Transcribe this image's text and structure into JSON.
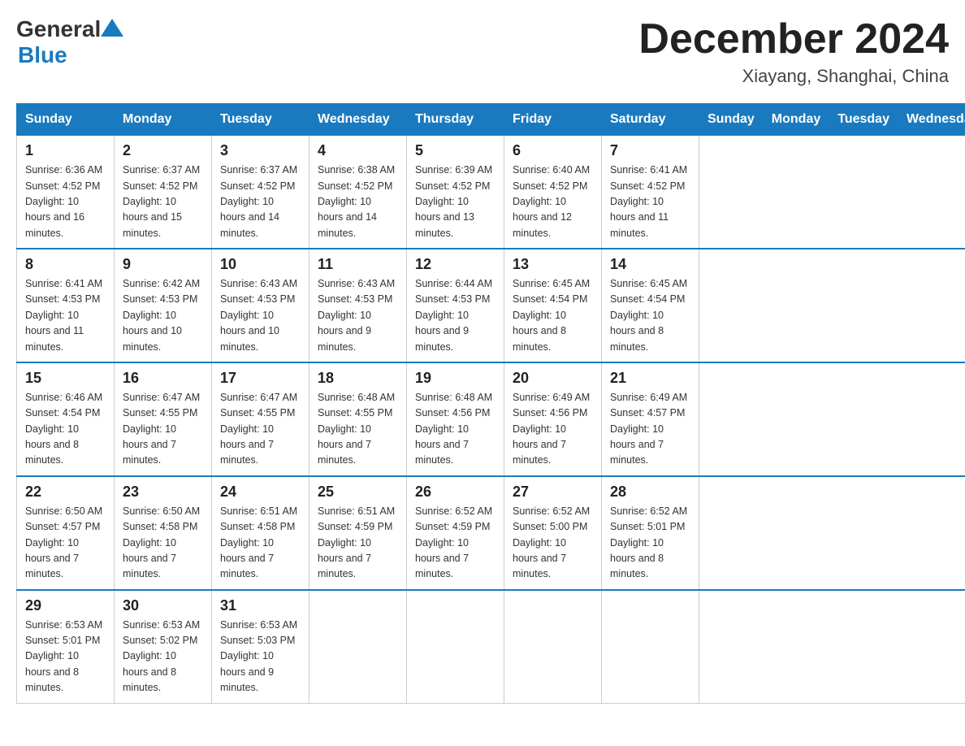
{
  "logo": {
    "general": "General",
    "blue": "Blue"
  },
  "title": "December 2024",
  "location": "Xiayang, Shanghai, China",
  "days_of_week": [
    "Sunday",
    "Monday",
    "Tuesday",
    "Wednesday",
    "Thursday",
    "Friday",
    "Saturday"
  ],
  "weeks": [
    [
      {
        "day": "1",
        "sunrise": "6:36 AM",
        "sunset": "4:52 PM",
        "daylight": "10 hours and 16 minutes."
      },
      {
        "day": "2",
        "sunrise": "6:37 AM",
        "sunset": "4:52 PM",
        "daylight": "10 hours and 15 minutes."
      },
      {
        "day": "3",
        "sunrise": "6:37 AM",
        "sunset": "4:52 PM",
        "daylight": "10 hours and 14 minutes."
      },
      {
        "day": "4",
        "sunrise": "6:38 AM",
        "sunset": "4:52 PM",
        "daylight": "10 hours and 14 minutes."
      },
      {
        "day": "5",
        "sunrise": "6:39 AM",
        "sunset": "4:52 PM",
        "daylight": "10 hours and 13 minutes."
      },
      {
        "day": "6",
        "sunrise": "6:40 AM",
        "sunset": "4:52 PM",
        "daylight": "10 hours and 12 minutes."
      },
      {
        "day": "7",
        "sunrise": "6:41 AM",
        "sunset": "4:52 PM",
        "daylight": "10 hours and 11 minutes."
      }
    ],
    [
      {
        "day": "8",
        "sunrise": "6:41 AM",
        "sunset": "4:53 PM",
        "daylight": "10 hours and 11 minutes."
      },
      {
        "day": "9",
        "sunrise": "6:42 AM",
        "sunset": "4:53 PM",
        "daylight": "10 hours and 10 minutes."
      },
      {
        "day": "10",
        "sunrise": "6:43 AM",
        "sunset": "4:53 PM",
        "daylight": "10 hours and 10 minutes."
      },
      {
        "day": "11",
        "sunrise": "6:43 AM",
        "sunset": "4:53 PM",
        "daylight": "10 hours and 9 minutes."
      },
      {
        "day": "12",
        "sunrise": "6:44 AM",
        "sunset": "4:53 PM",
        "daylight": "10 hours and 9 minutes."
      },
      {
        "day": "13",
        "sunrise": "6:45 AM",
        "sunset": "4:54 PM",
        "daylight": "10 hours and 8 minutes."
      },
      {
        "day": "14",
        "sunrise": "6:45 AM",
        "sunset": "4:54 PM",
        "daylight": "10 hours and 8 minutes."
      }
    ],
    [
      {
        "day": "15",
        "sunrise": "6:46 AM",
        "sunset": "4:54 PM",
        "daylight": "10 hours and 8 minutes."
      },
      {
        "day": "16",
        "sunrise": "6:47 AM",
        "sunset": "4:55 PM",
        "daylight": "10 hours and 7 minutes."
      },
      {
        "day": "17",
        "sunrise": "6:47 AM",
        "sunset": "4:55 PM",
        "daylight": "10 hours and 7 minutes."
      },
      {
        "day": "18",
        "sunrise": "6:48 AM",
        "sunset": "4:55 PM",
        "daylight": "10 hours and 7 minutes."
      },
      {
        "day": "19",
        "sunrise": "6:48 AM",
        "sunset": "4:56 PM",
        "daylight": "10 hours and 7 minutes."
      },
      {
        "day": "20",
        "sunrise": "6:49 AM",
        "sunset": "4:56 PM",
        "daylight": "10 hours and 7 minutes."
      },
      {
        "day": "21",
        "sunrise": "6:49 AM",
        "sunset": "4:57 PM",
        "daylight": "10 hours and 7 minutes."
      }
    ],
    [
      {
        "day": "22",
        "sunrise": "6:50 AM",
        "sunset": "4:57 PM",
        "daylight": "10 hours and 7 minutes."
      },
      {
        "day": "23",
        "sunrise": "6:50 AM",
        "sunset": "4:58 PM",
        "daylight": "10 hours and 7 minutes."
      },
      {
        "day": "24",
        "sunrise": "6:51 AM",
        "sunset": "4:58 PM",
        "daylight": "10 hours and 7 minutes."
      },
      {
        "day": "25",
        "sunrise": "6:51 AM",
        "sunset": "4:59 PM",
        "daylight": "10 hours and 7 minutes."
      },
      {
        "day": "26",
        "sunrise": "6:52 AM",
        "sunset": "4:59 PM",
        "daylight": "10 hours and 7 minutes."
      },
      {
        "day": "27",
        "sunrise": "6:52 AM",
        "sunset": "5:00 PM",
        "daylight": "10 hours and 7 minutes."
      },
      {
        "day": "28",
        "sunrise": "6:52 AM",
        "sunset": "5:01 PM",
        "daylight": "10 hours and 8 minutes."
      }
    ],
    [
      {
        "day": "29",
        "sunrise": "6:53 AM",
        "sunset": "5:01 PM",
        "daylight": "10 hours and 8 minutes."
      },
      {
        "day": "30",
        "sunrise": "6:53 AM",
        "sunset": "5:02 PM",
        "daylight": "10 hours and 8 minutes."
      },
      {
        "day": "31",
        "sunrise": "6:53 AM",
        "sunset": "5:03 PM",
        "daylight": "10 hours and 9 minutes."
      },
      null,
      null,
      null,
      null
    ]
  ]
}
